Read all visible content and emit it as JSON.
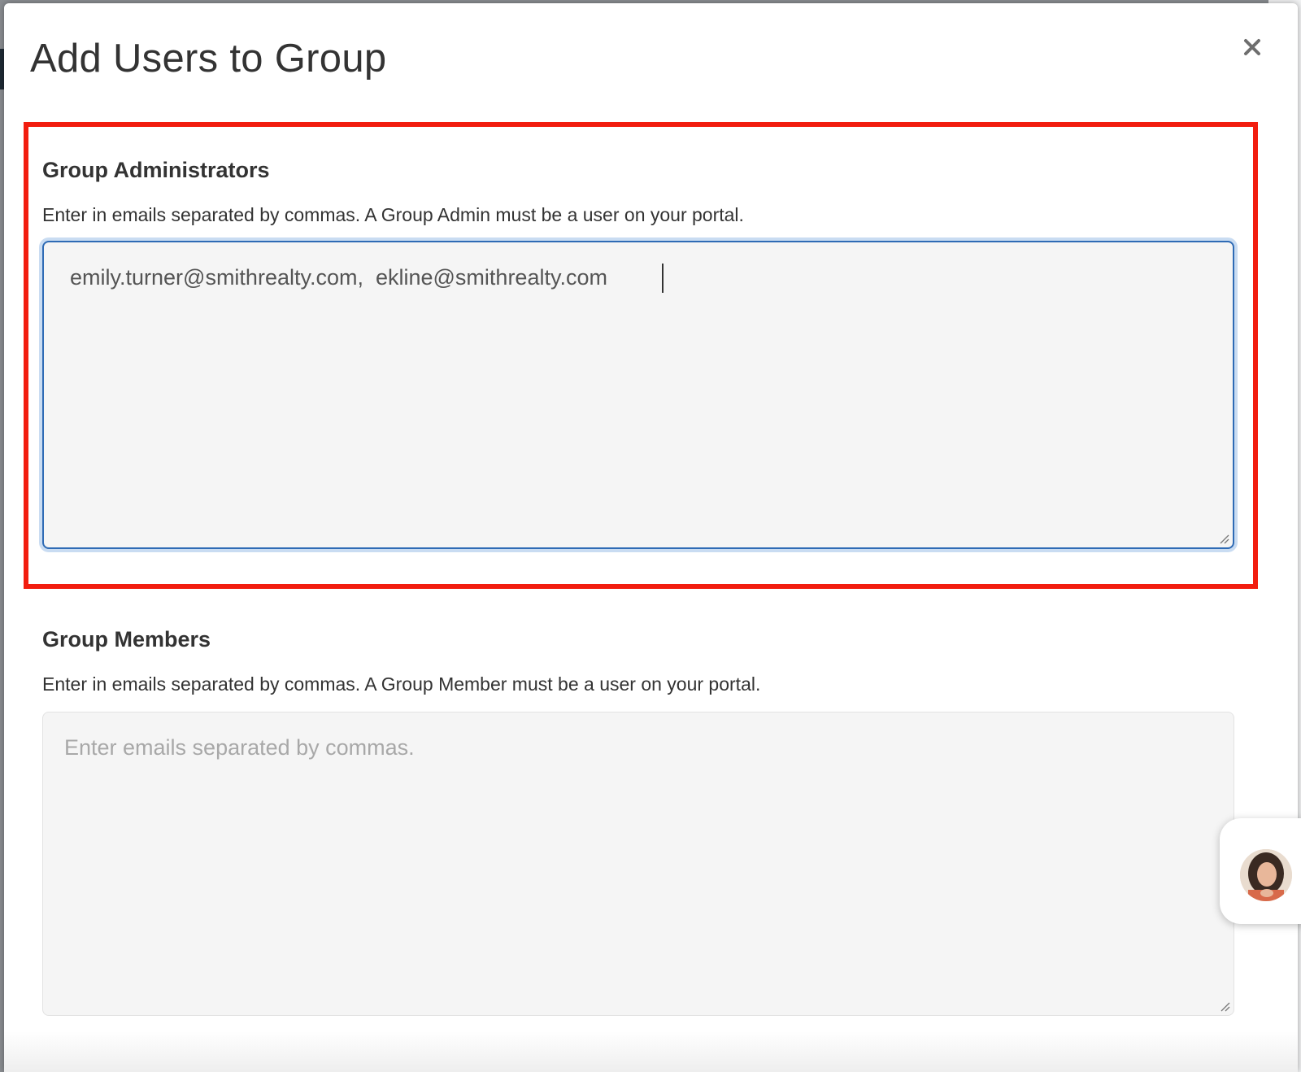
{
  "modal": {
    "title": "Add Users to Group",
    "close_icon": "close-icon"
  },
  "admins": {
    "label": "Group Administrators",
    "help": "Enter in emails separated by commas. A Group Admin must be a user on your portal.",
    "value": "emily.turner@smithrealty.com,  ekline@smithrealty.com"
  },
  "members": {
    "label": "Group Members",
    "help": "Enter in emails separated by commas. A Group Member must be a user on your portal.",
    "placeholder": "Enter emails separated by commas."
  },
  "chat": {
    "avatar_icon": "agent-avatar-icon"
  },
  "colors": {
    "highlight": "#f21d0f",
    "focus_border": "#2f6bb5",
    "textarea_bg": "#f5f5f5"
  }
}
